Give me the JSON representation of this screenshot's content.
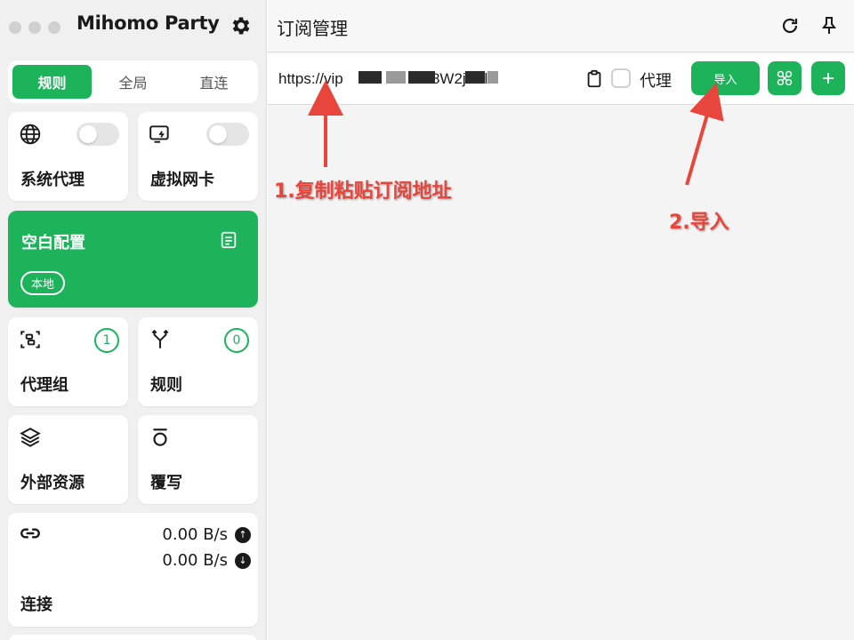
{
  "app": {
    "title": "Mihomo Party"
  },
  "mode_tabs": [
    {
      "label": "规则",
      "active": true
    },
    {
      "label": "全局",
      "active": false
    },
    {
      "label": "直连",
      "active": false
    }
  ],
  "cards": {
    "system_proxy": {
      "label": "系统代理",
      "enabled": false
    },
    "virtual_nic": {
      "label": "虚拟网卡",
      "enabled": false
    },
    "profile": {
      "label": "空白配置",
      "badge": "本地"
    },
    "proxy_group": {
      "label": "代理组",
      "count": "1"
    },
    "rules": {
      "label": "规则",
      "count": "0"
    },
    "external_resources": {
      "label": "外部资源"
    },
    "override": {
      "label": "覆写"
    },
    "connections": {
      "label": "连接",
      "upload": "0.00 B/s",
      "download": "0.00 B/s"
    }
  },
  "main": {
    "title": "订阅管理",
    "url_input": {
      "value_prefix": "https://vip",
      "value_suffix": "/8W2j3Kl",
      "value": "https://vip                    /8W2j3Kl"
    },
    "proxy_checkbox": {
      "label": "代理",
      "checked": false
    },
    "import_button": "导入"
  },
  "annotations": {
    "step1": "1.复制粘贴订阅地址",
    "step2": "2.导入"
  },
  "colors": {
    "accent": "#1db35b",
    "annotation": "#e8453c",
    "sidebar_bg": "#f0f0f0"
  },
  "icons": {
    "settings": "gear-icon",
    "refresh": "refresh-icon",
    "pin": "pin-icon",
    "globe": "globe-icon",
    "tun": "monitor-bolt-icon",
    "document": "document-icon",
    "proxy_group": "scan-group-icon",
    "rules": "fork-icon",
    "resources": "layers-icon",
    "override": "override-icon",
    "link": "link-icon",
    "clipboard": "clipboard-icon",
    "update_all": "sync-icon",
    "add": "plus-icon"
  }
}
